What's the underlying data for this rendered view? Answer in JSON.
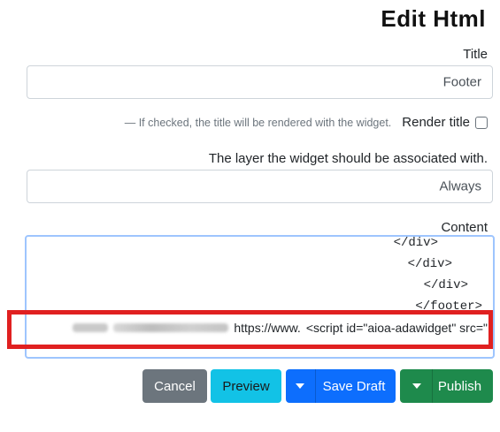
{
  "page": {
    "title": "Edit Html"
  },
  "title_field": {
    "label": "Title",
    "value": "Footer"
  },
  "render_title": {
    "label": "Render title",
    "help": "— If checked, the title will be rendered with the widget."
  },
  "layer_field": {
    "label": "The layer the widget should be associated with.",
    "value": "Always"
  },
  "content_field": {
    "label": "Content",
    "lines": [
      "</div>",
      "</div>",
      "</div>",
      "</footer>"
    ],
    "script_line_prefix": "<script id=\"aioa-adawidget\" src=\"",
    "script_line_url_prefix": "https://www."
  },
  "buttons": {
    "publish": "Publish",
    "save_draft": "Save Draft",
    "preview": "Preview",
    "cancel": "Cancel"
  },
  "colors": {
    "publish": "#1e8a4c",
    "save_draft": "#0d6efd",
    "preview": "#12c2e6",
    "cancel": "#6c757d",
    "highlight": "#e02020"
  },
  "icons": {
    "dropdown": "caret-down-icon"
  }
}
